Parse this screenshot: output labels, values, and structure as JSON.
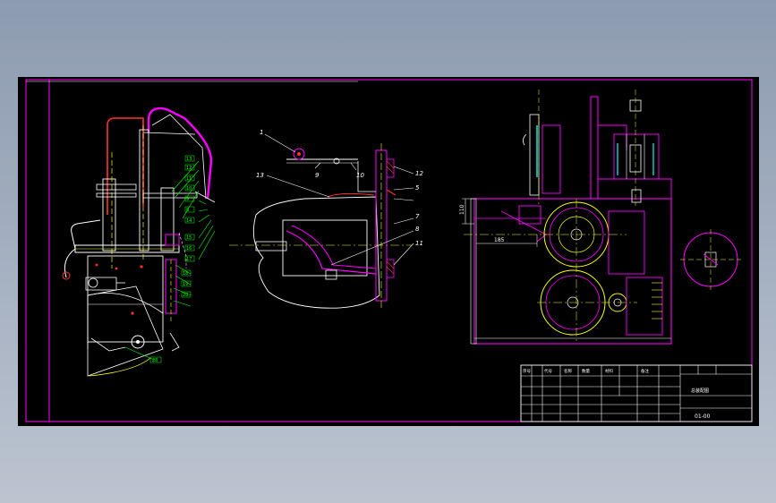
{
  "colors": {
    "background": "#000000",
    "frame": "#ff00ff",
    "line": "#ffffff",
    "yellow": "#ffff00",
    "green": "#00ff00",
    "red": "#ff3030",
    "cyan": "#00ffff",
    "magenta": "#ff00ff"
  },
  "left_view": {
    "balloons": [
      "13",
      "12",
      "11",
      "10",
      "9",
      "8",
      "14",
      "15",
      "16",
      "17",
      "18",
      "19",
      "20"
    ],
    "base_label": "28"
  },
  "middle_view": {
    "labels": [
      "1",
      "13",
      "9",
      "10",
      "12",
      "5",
      "7",
      "8",
      "11"
    ]
  },
  "right_view": {
    "dim_vertical": "110",
    "dim_horizontal": "185"
  },
  "title_block": {
    "header_cells": [
      "序号",
      "代号",
      "名称",
      "数量",
      "材料",
      "备注"
    ],
    "drawing_name": "总装配图",
    "drawing_number": "01-00"
  }
}
